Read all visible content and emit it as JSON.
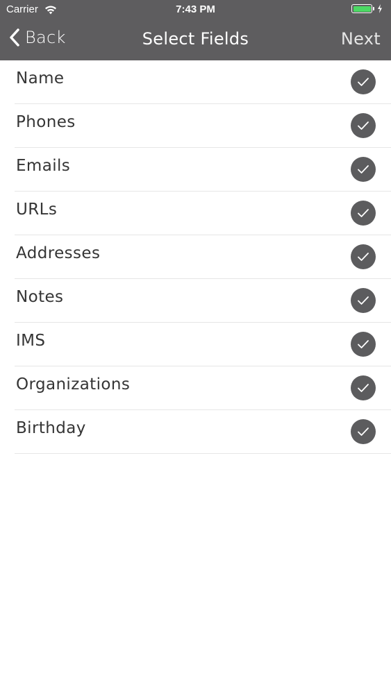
{
  "status_bar": {
    "carrier": "Carrier",
    "time": "7:43 PM",
    "battery_color": "#4cd964"
  },
  "nav": {
    "back_label": "Back",
    "title": "Select Fields",
    "next_label": "Next",
    "background": "#5e5d5f"
  },
  "fields": [
    {
      "label": "Name",
      "checked": true
    },
    {
      "label": "Phones",
      "checked": true
    },
    {
      "label": "Emails",
      "checked": true
    },
    {
      "label": "URLs",
      "checked": true
    },
    {
      "label": "Addresses",
      "checked": true
    },
    {
      "label": "Notes",
      "checked": true
    },
    {
      "label": "IMS",
      "checked": true
    },
    {
      "label": "Organizations",
      "checked": true
    },
    {
      "label": "Birthday",
      "checked": true
    }
  ],
  "icons": {
    "checkmark": "checkmark-circle-icon",
    "back": "chevron-left-icon",
    "wifi": "wifi-icon",
    "battery": "battery-icon",
    "charging": "charging-bolt-icon"
  }
}
